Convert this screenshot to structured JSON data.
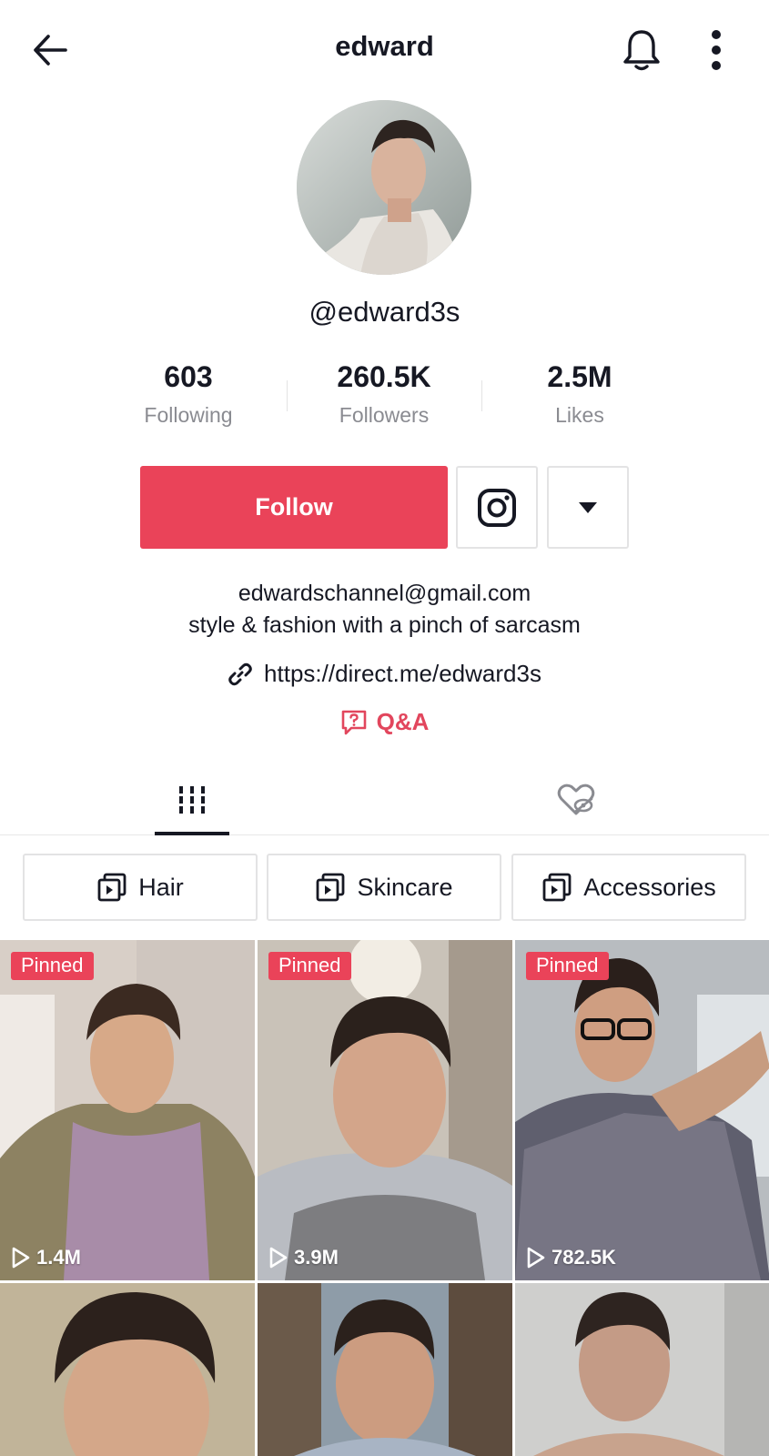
{
  "header": {
    "title": "edward",
    "back_icon": "arrow-left-icon",
    "bell_icon": "bell-icon",
    "more_icon": "more-vertical-icon"
  },
  "profile": {
    "handle": "@edward3s",
    "stats": [
      {
        "value": "603",
        "label": "Following"
      },
      {
        "value": "260.5K",
        "label": "Followers"
      },
      {
        "value": "2.5M",
        "label": "Likes"
      }
    ],
    "follow_label": "Follow",
    "bio_line1": "edwardschannel@gmail.com",
    "bio_line2": "style & fashion with a pinch of sarcasm",
    "link": "https://direct.me/edward3s",
    "qa_label": "Q&A"
  },
  "playlists": [
    {
      "label": "Hair"
    },
    {
      "label": "Skincare"
    },
    {
      "label": "Accessories"
    }
  ],
  "videos": [
    {
      "pinned": "Pinned",
      "views": "1.4M"
    },
    {
      "pinned": "Pinned",
      "views": "3.9M"
    },
    {
      "pinned": "Pinned",
      "views": "782.5K"
    },
    {
      "pinned": "",
      "views": ""
    },
    {
      "pinned": "",
      "views": ""
    },
    {
      "pinned": "",
      "views": ""
    }
  ],
  "colors": {
    "accent": "#ea4359",
    "text": "#161823",
    "muted": "#8a8b91",
    "border": "#e3e3e4"
  }
}
